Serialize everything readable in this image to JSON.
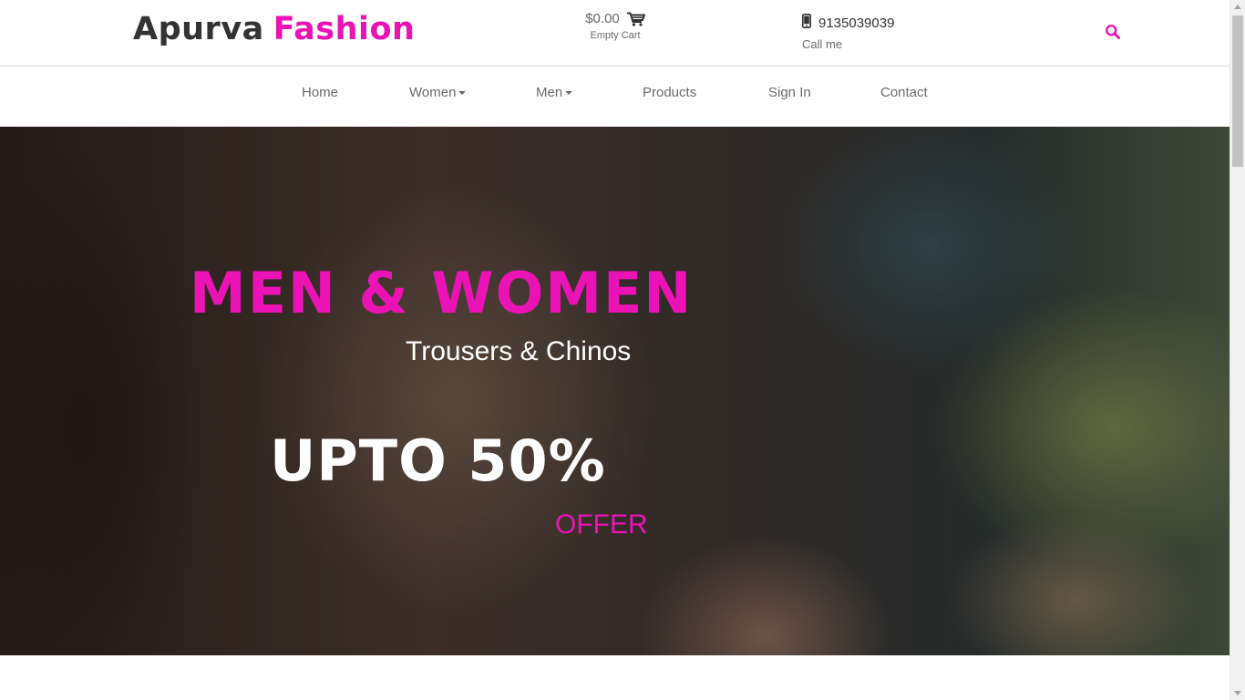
{
  "brand": {
    "name_part1": "Apurva",
    "name_part2": "Fashion",
    "accent_color": "#ec13b6"
  },
  "cart": {
    "total": "$0.00",
    "status": "Empty Cart",
    "icon": "cart-icon"
  },
  "contact": {
    "phone": "9135039039",
    "caption": "Call me",
    "icon": "mobile-phone-icon"
  },
  "search": {
    "icon": "search-icon"
  },
  "nav": {
    "items": [
      {
        "label": "Home",
        "has_dropdown": false
      },
      {
        "label": "Women",
        "has_dropdown": true
      },
      {
        "label": "Men",
        "has_dropdown": true
      },
      {
        "label": "Products",
        "has_dropdown": false
      },
      {
        "label": "Sign In",
        "has_dropdown": false
      },
      {
        "label": "Contact",
        "has_dropdown": false
      }
    ]
  },
  "hero": {
    "title": "MEN & WOMEN",
    "subtitle": "Trousers & Chinos",
    "discount": "UPTO 50%",
    "offer": "OFFER"
  }
}
